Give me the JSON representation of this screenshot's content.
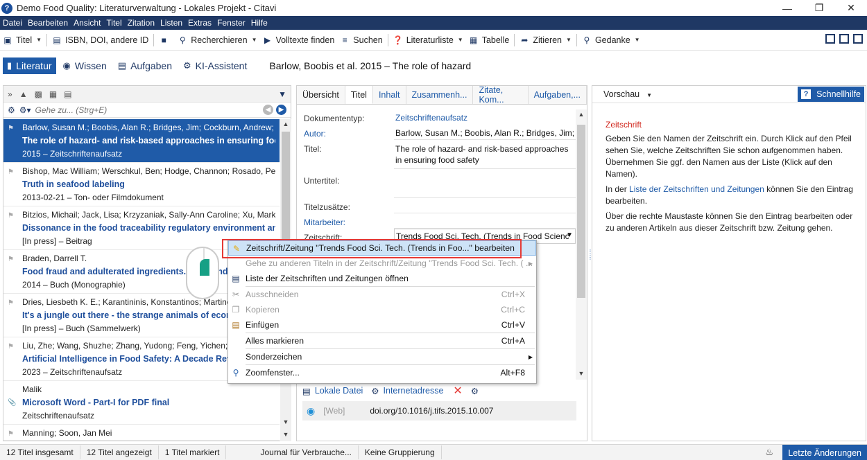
{
  "window": {
    "title": "Demo Food Quality: Literaturverwaltung - Lokales Projekt - Citavi"
  },
  "menubar": [
    "Datei",
    "Bearbeiten",
    "Ansicht",
    "Titel",
    "Zitation",
    "Listen",
    "Extras",
    "Fenster",
    "Hilfe"
  ],
  "toolbar": {
    "titel": "Titel",
    "isbn": "ISBN, DOI, andere ID",
    "recherchieren": "Recherchieren",
    "volltexte": "Volltexte finden",
    "suchen": "Suchen",
    "literaturliste": "Literaturliste",
    "tabelle": "Tabelle",
    "zitieren": "Zitieren",
    "gedanke": "Gedanke"
  },
  "modes": {
    "literatur": "Literatur",
    "wissen": "Wissen",
    "aufgaben": "Aufgaben",
    "ki": "KI-Assistent",
    "current_reference": "Barlow, Boobis et al. 2015 – The role of hazard"
  },
  "search": {
    "placeholder": "Gehe zu... (Strg+E)"
  },
  "references": [
    {
      "authors": "Barlow, Susan M.; Boobis, Alan R.; Bridges, Jim; Cockburn, Andrew; D",
      "title": "The role of hazard- and risk-based approaches in ensuring food saf",
      "meta": "2015 – Zeitschriftenaufsatz"
    },
    {
      "authors": "Bishop, Mac William; Werschkul, Ben; Hodge, Channon; Rosado, Pedr",
      "title": "Truth in seafood labeling",
      "meta": "2013-02-21 – Ton- oder Filmdokument"
    },
    {
      "authors": "Bitzios, Michail; Jack, Lisa; Krzyzaniak, Sally-Ann Caroline; Xu, Mark",
      "title": "Dissonance in the food traceability regulatory environment and fo",
      "meta": "[In press] – Beitrag"
    },
    {
      "authors": "Braden, Darrell T.",
      "title": "Food fraud and adulterated ingredients. Ba...ound,",
      "meta": "2014 – Buch (Monographie)"
    },
    {
      "authors": "Dries, Liesbeth K. E.; Karantininis, Konstantinos; Martino, G",
      "title": "It's a jungle out there - the strange animals of econom",
      "meta": "[In press] – Buch (Sammelwerk)"
    },
    {
      "authors": "Liu, Zhe; Wang, Shuzhe; Zhang, Yudong; Feng, Yichen; Liu",
      "title": "Artificial Intelligence in Food Safety: A Decade Review",
      "meta": "2023 – Zeitschriftenaufsatz"
    },
    {
      "authors": "Malik",
      "title": "Microsoft Word - Part-I for PDF final",
      "meta": "Zeitschriftenaufsatz"
    },
    {
      "authors": "Manning; Soon, Jan Mei",
      "title": "",
      "meta": ""
    }
  ],
  "tabs": [
    "Übersicht",
    "Titel",
    "Inhalt",
    "Zusammenh...",
    "Zitate, Kom...",
    "Aufgaben,..."
  ],
  "fields": {
    "dokumententyp_label": "Dokumententyp:",
    "dokumententyp_value": "Zeitschriftenaufsatz",
    "autor_label": "Autor:",
    "autor_value": "Barlow, Susan M.; Boobis, Alan R.; Bridges, Jim; C",
    "titel_label": "Titel:",
    "titel_value": "The role of hazard- and risk-based approaches in ensuring food safety",
    "untertitel_label": "Untertitel:",
    "titelzusaetze_label": "Titelzusätze:",
    "mitarbeiter_label": "Mitarbeiter:",
    "zeitschrift_label": "Zeitschrift:",
    "zeitschrift_value": "Trends Food Sci. Tech. (Trends in Food Scienc"
  },
  "attachments": {
    "lokale_datei": "Lokale Datei",
    "internetadresse": "Internetadresse",
    "web_tag": "[Web]",
    "doi": "doi.org/10.1016/j.tifs.2015.10.007"
  },
  "context_menu": [
    {
      "label": "Zeitschrift/Zeitung \"Trends Food Sci. Tech. (Trends in Foo...\" bearbeiten",
      "shortcut": "",
      "disabled": false
    },
    {
      "label": "Gehe zu anderen Titeln in der Zeitschrift/Zeitung \"Trends Food Sci. Tech. ( ...",
      "shortcut": "",
      "disabled": true
    },
    {
      "label": "Liste der Zeitschriften und Zeitungen öffnen",
      "shortcut": "",
      "disabled": false
    },
    {
      "label": "Ausschneiden",
      "shortcut": "Ctrl+X",
      "disabled": true
    },
    {
      "label": "Kopieren",
      "shortcut": "Ctrl+C",
      "disabled": true
    },
    {
      "label": "Einfügen",
      "shortcut": "Ctrl+V",
      "disabled": false
    },
    {
      "label": "Alles markieren",
      "shortcut": "Ctrl+A",
      "disabled": false
    },
    {
      "label": "Sonderzeichen",
      "shortcut": "",
      "disabled": false
    },
    {
      "label": "Zoomfenster...",
      "shortcut": "Alt+F8",
      "disabled": false
    }
  ],
  "preview": {
    "label": "Vorschau",
    "help_button": "Schnellhilfe",
    "help_title": "Zeitschrift",
    "help_p1": "Geben Sie den Namen der Zeitschrift ein. Durch Klick auf den Pfeil sehen Sie, welche Zeitschriften Sie schon aufgenommen haben. Übernehmen Sie ggf. den Namen aus der Liste (Klick auf den Namen).",
    "help_p2_prefix": "In der ",
    "help_p2_link": "Liste der Zeitschriften und Zeitungen",
    "help_p2_suffix": " können Sie den Eintrag bearbeiten.",
    "help_p3": "Über die rechte Maustaste können Sie den Eintrag bearbeiten oder zu anderen Artikeln aus dieser Zeitschrift bzw. Zeitung gehen."
  },
  "status": {
    "total": "12 Titel insgesamt",
    "shown": "12 Titel angezeigt",
    "marked": "1 Titel markiert",
    "journal": "Journal für Verbrauche...",
    "grouping": "Keine Gruppierung",
    "last_changes": "Letzte Änderungen"
  },
  "colors": {
    "menubar": "#1f3864",
    "accent": "#1f5ba8",
    "link": "#1f5ba8",
    "help_title": "#d0261c",
    "highlight_box": "#e53935",
    "mouse_button": "#16a085"
  }
}
